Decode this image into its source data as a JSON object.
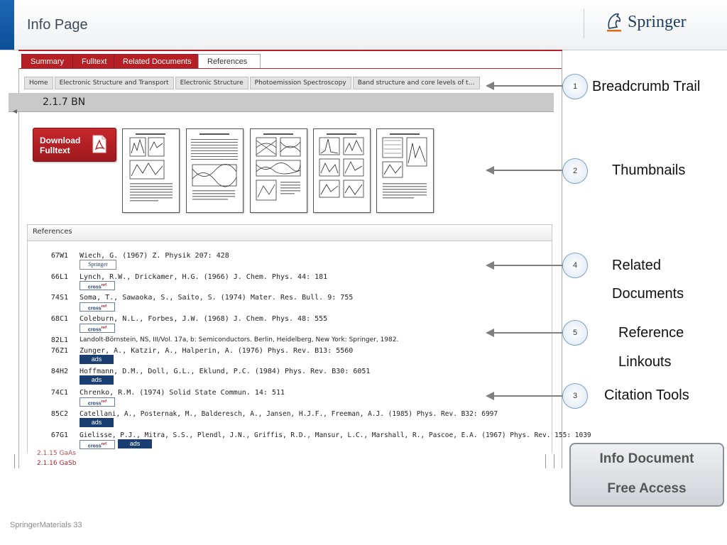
{
  "header": {
    "title": "Info Page",
    "logo_text": "Springer",
    "accent_color": "#0b4f96"
  },
  "tabs": [
    {
      "label": "Summary"
    },
    {
      "label": "Fulltext"
    },
    {
      "label": "Related Documents"
    },
    {
      "label": "References"
    }
  ],
  "breadcrumb": [
    "Home",
    "Electronic Structure and Transport",
    "Electronic Structure",
    "Photoemission Spectroscopy",
    "Band structure and core levels of t…"
  ],
  "section": {
    "title": "2.1.7 BN"
  },
  "download": {
    "label_line1": "Download",
    "label_line2": "Fulltext",
    "pdf_icon_text": "PDF"
  },
  "references": {
    "header": "References",
    "items": [
      {
        "code": "67W1",
        "text": "Wiech, G. (1967) Z. Physik 207: 428",
        "badges": [
          "springer"
        ]
      },
      {
        "code": "66L1",
        "text": "Lynch, R.W., Drickamer, H.G. (1966) J. Chem. Phys. 44: 181",
        "badges": [
          "crossref"
        ]
      },
      {
        "code": "74S1",
        "text": "Soma, T., Sawaoka, S., Saito, S. (1974) Mater. Res. Bull. 9: 755",
        "badges": [
          "crossref"
        ]
      },
      {
        "code": "68C1",
        "text": "Coleburn, N.L., Forbes, J.W. (1968) J. Chem. Phys. 48: 555",
        "badges": [
          "crossref"
        ]
      },
      {
        "code": "82L1",
        "text": "Landolt-Börnstein, NS, III/Vol. 17a, b: Semiconductors. Berlin, Heidelberg, New York: Springer, 1982.",
        "badges": []
      },
      {
        "code": "76Z1",
        "text": "Zunger, A., Katzir, A., Halperin, A. (1976) Phys. Rev. B13: 5560",
        "badges": [
          "ads"
        ]
      },
      {
        "code": "84H2",
        "text": "Hoffmann, D.M., Doll, G.L., Eklund, P.C. (1984) Phys. Rev. B30: 6051",
        "badges": [
          "ads"
        ]
      },
      {
        "code": "74C1",
        "text": "Chrenko, R.M. (1974) Solid State Commun. 14: 511",
        "badges": [
          "crossref"
        ]
      },
      {
        "code": "85C2",
        "text": "Catellani, A., Posternak, M., Balderesch, A., Jansen, H.J.F., Freeman, A.J. (1985) Phys. Rev. B32: 6997",
        "badges": [
          "ads"
        ]
      },
      {
        "code": "67G1",
        "text": "Gielisse, P.J., Mitra, S.S., Plendl, J.N., Griffis, R.D., Mansur, L.C., Marshall, R., Pascoe, E.A. (1967) Phys. Rev. 155: 1039",
        "badges": [
          "crossref",
          "ads"
        ]
      }
    ],
    "badge_labels": {
      "springer": "Springer",
      "crossref": "cross",
      "crossref_sup": "ref",
      "ads": "ads"
    }
  },
  "toc": {
    "items": [
      "2.1.15 GaAs",
      "2.1.16 GaSb"
    ]
  },
  "callouts": [
    {
      "number": "1",
      "label_lines": [
        "Breadcrumb Trail"
      ]
    },
    {
      "number": "2",
      "label_lines": [
        "Thumbnails"
      ]
    },
    {
      "number": "4",
      "label_lines": [
        "Related",
        "Documents"
      ]
    },
    {
      "number": "5",
      "label_lines": [
        "Reference",
        "Linkouts"
      ]
    },
    {
      "number": "3",
      "label_lines": [
        "Citation Tools"
      ]
    }
  ],
  "info_box": {
    "line1": "Info Document",
    "line2": "Free Access"
  },
  "footer": {
    "text": "SpringerMaterials 33"
  }
}
